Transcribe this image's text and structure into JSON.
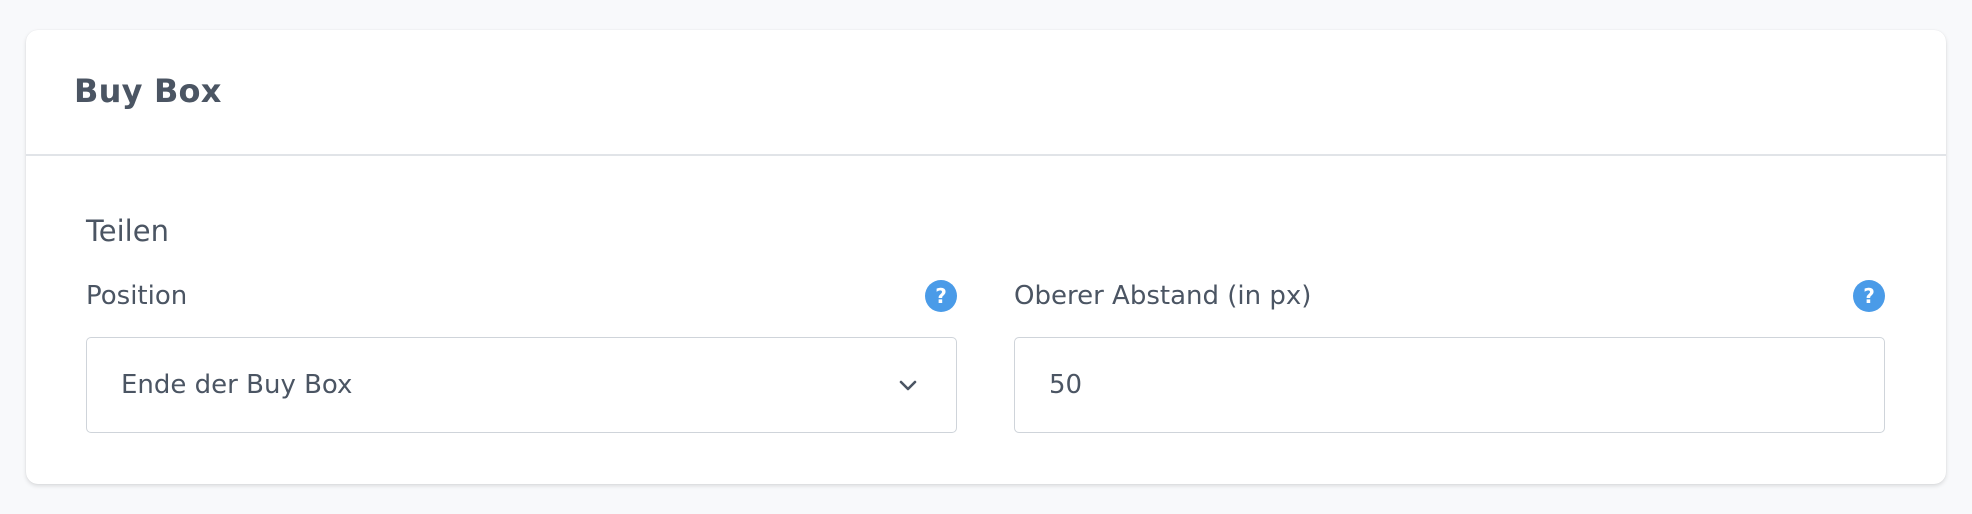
{
  "card": {
    "title": "Buy Box",
    "section_title": "Teilen"
  },
  "fields": {
    "position": {
      "label": "Position",
      "value": "Ende der Buy Box",
      "help_icon": "question-circle-icon"
    },
    "top_margin": {
      "label": "Oberer Abstand (in px)",
      "value": "50",
      "help_icon": "question-circle-icon"
    }
  },
  "colors": {
    "help_icon": "#4a9be8",
    "text": "#4b5563",
    "border": "#cfd4da"
  }
}
